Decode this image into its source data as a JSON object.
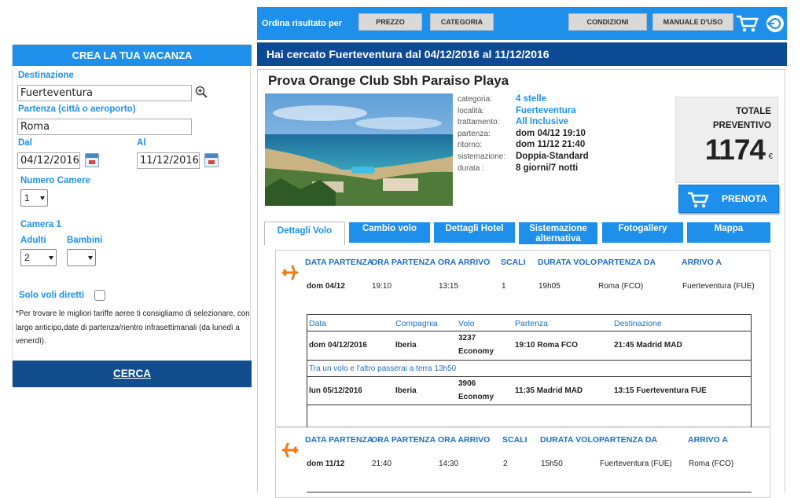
{
  "sidebar": {
    "header": "CREA LA TUA VACANZA",
    "destinazione_label": "Destinazione",
    "destinazione_value": "Fuerteventura",
    "partenza_label": "Partenza (città o aeroporto)",
    "partenza_value": "Roma",
    "dal_label": "Dal",
    "dal_value": "04/12/2016",
    "al_label": "Al",
    "al_value": "11/12/2016",
    "camere_label": "Numero Camere",
    "camere_value": "1",
    "camera1_label": "Camera 1",
    "adulti_label": "Adulti",
    "adulti_value": "2",
    "bambini_label": "Bambini",
    "bambini_value": "",
    "solo_voli_label": "Solo voli diretti",
    "note": "*Per trovare le migliori tariffe aeree ti consigliamo di selezionare, con largo anticipo,date di partenza/rientro infrasettimanali (da lunedì a venerdì).",
    "cerca": "CERCA"
  },
  "topbar": {
    "ordina": "Ordina risultato per",
    "prezzo": "PREZZO",
    "categoria": "CATEGORIA",
    "condizioni": "CONDIZIONI",
    "manuale": "MANUALE D'USO"
  },
  "search_summary": "Hai cercato Fuerteventura dal 04/12/2016 al 11/12/2016",
  "hotel": {
    "name": "Prova Orange Club Sbh Paraiso Playa",
    "info": [
      {
        "k": "categoria:",
        "v": "4 stelle",
        "blue": true
      },
      {
        "k": "località:",
        "v": "Fuerteventura",
        "blue": true
      },
      {
        "k": "trattamento:",
        "v": "All Inclusive",
        "blue": true
      },
      {
        "k": "partenza:",
        "v": "dom 04/12 19:10",
        "blue": false
      },
      {
        "k": "ritorno:",
        "v": "dom 11/12 21:40",
        "blue": false
      },
      {
        "k": "sistemazione:",
        "v": "Doppia-Standard",
        "blue": false
      },
      {
        "k": "durata :",
        "v": "8 giorni/7 notti",
        "blue": false
      }
    ],
    "totale_label_1": "TOTALE",
    "totale_label_2": "PREVENTIVO",
    "price": "1174",
    "currency": "€",
    "prenota": "PRENOTA"
  },
  "tabs": {
    "t1": "Dettagli Volo",
    "t2": "Cambio volo",
    "t3": "Dettagli Hotel",
    "t4a": "Sistemazione",
    "t4b": "alternativa",
    "t5": "Fotogallery",
    "t6": "Mappa"
  },
  "flight_headers": [
    "DATA PARTENZA",
    "ORA PARTENZA",
    "ORA ARRIVO",
    "SCALI",
    "DURATA VOLO",
    "PARTENZA DA",
    "ARRIVO A"
  ],
  "outbound": [
    "dom 04/12",
    "19:10",
    "13:15",
    "1",
    "19h05",
    "Roma (FCO)",
    "Fuerteventura (FUE)"
  ],
  "inbound": [
    "dom 11/12",
    "21:40",
    "14:30",
    "2",
    "15h50",
    "Fuerteventura (FUE)",
    "Roma (FCO)"
  ],
  "legs_headers": [
    "Data",
    "Compagnia",
    "Volo",
    "Partenza",
    "Destinazione"
  ],
  "legs": [
    {
      "data": "dom 04/12/2016",
      "compagnia": "Iberia",
      "volo": "3237",
      "classe": "Economy",
      "partenza": "19:10 Roma FCO",
      "destinazione": "21:45 Madrid MAD"
    },
    {
      "data": "lun 05/12/2016",
      "compagnia": "Iberia",
      "volo": "3906",
      "classe": "Economy",
      "partenza": "11:35 Madrid MAD",
      "destinazione": "13:15 Fuerteventura FUE"
    }
  ],
  "layover": "Tra un volo e l'altro passerai a terra 13h50",
  "colors": {
    "accent": "#1e90ec",
    "dark": "#0d4a94",
    "plane": "#f07a1a"
  }
}
